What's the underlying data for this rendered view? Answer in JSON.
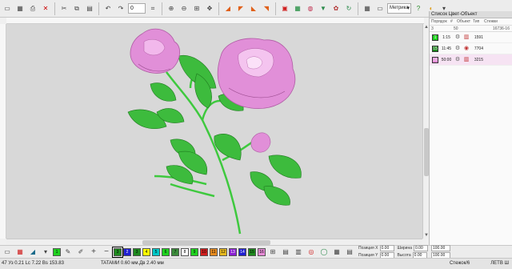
{
  "toolbar": {
    "stitch_count": "0",
    "units_select": "Метрика"
  },
  "panel": {
    "title": "Список Цвет-Объект",
    "headers": [
      "Порядок",
      "#",
      "Объект",
      "Тип",
      "Стежки"
    ],
    "sub": [
      "3",
      "50",
      "16736-16"
    ],
    "rows": [
      {
        "index": "1",
        "color": "#1fd11f",
        "time": "1:15",
        "count": "1591"
      },
      {
        "index": "15",
        "color": "#1f8a1f",
        "time": "11:45",
        "count": "7704"
      },
      {
        "index": "16",
        "color": "#e68ad6",
        "time": "50:00",
        "count": "3215"
      }
    ]
  },
  "bottom_colors": [
    {
      "label": "1",
      "color": "#1fd11f"
    },
    {
      "label": "2",
      "color": "#1f1fd1"
    },
    {
      "label": "3",
      "color": "#1f8a1f"
    },
    {
      "label": "4",
      "color": "#ffff00"
    },
    {
      "label": "5",
      "color": "#00c8c8"
    },
    {
      "label": "6",
      "color": "#1fd11f"
    },
    {
      "label": "7",
      "color": "#3a8a3a"
    },
    {
      "label": "8",
      "color": "#ffffff"
    },
    {
      "label": "9",
      "color": "#1fd11f"
    },
    {
      "label": "10",
      "color": "#d11f1f"
    },
    {
      "label": "11",
      "color": "#e68a1f"
    },
    {
      "label": "12",
      "color": "#e6b81f"
    },
    {
      "label": "13",
      "color": "#8a1fd1"
    },
    {
      "label": "14",
      "color": "#1f1fd1"
    },
    {
      "label": "15",
      "color": "#1f8a1f"
    },
    {
      "label": "16",
      "color": "#e68ad6"
    }
  ],
  "fields": {
    "pos_x_label": "Позиция X",
    "pos_y_label": "Позиция Y",
    "width_label": "Ширина",
    "height_label": "Высота",
    "pos_x": "0.00",
    "pos_y": "0.00",
    "width": "0.00",
    "height": "0.00",
    "scale1": "100.00",
    "scale2": "100.00"
  },
  "status": {
    "left": "47 Уз  0.21 Lc  7.22 Bs  153.83",
    "mid": "TATAMИ  0.60 мм.Дв  2.40 мм",
    "right": "Стежок/6",
    "far": "ЛЕТВ Ш"
  },
  "colors": {
    "canvas_bg": "#d8d8d8",
    "leaf_green": "#3dbb3d",
    "rose_pink": "#e18fd8"
  }
}
